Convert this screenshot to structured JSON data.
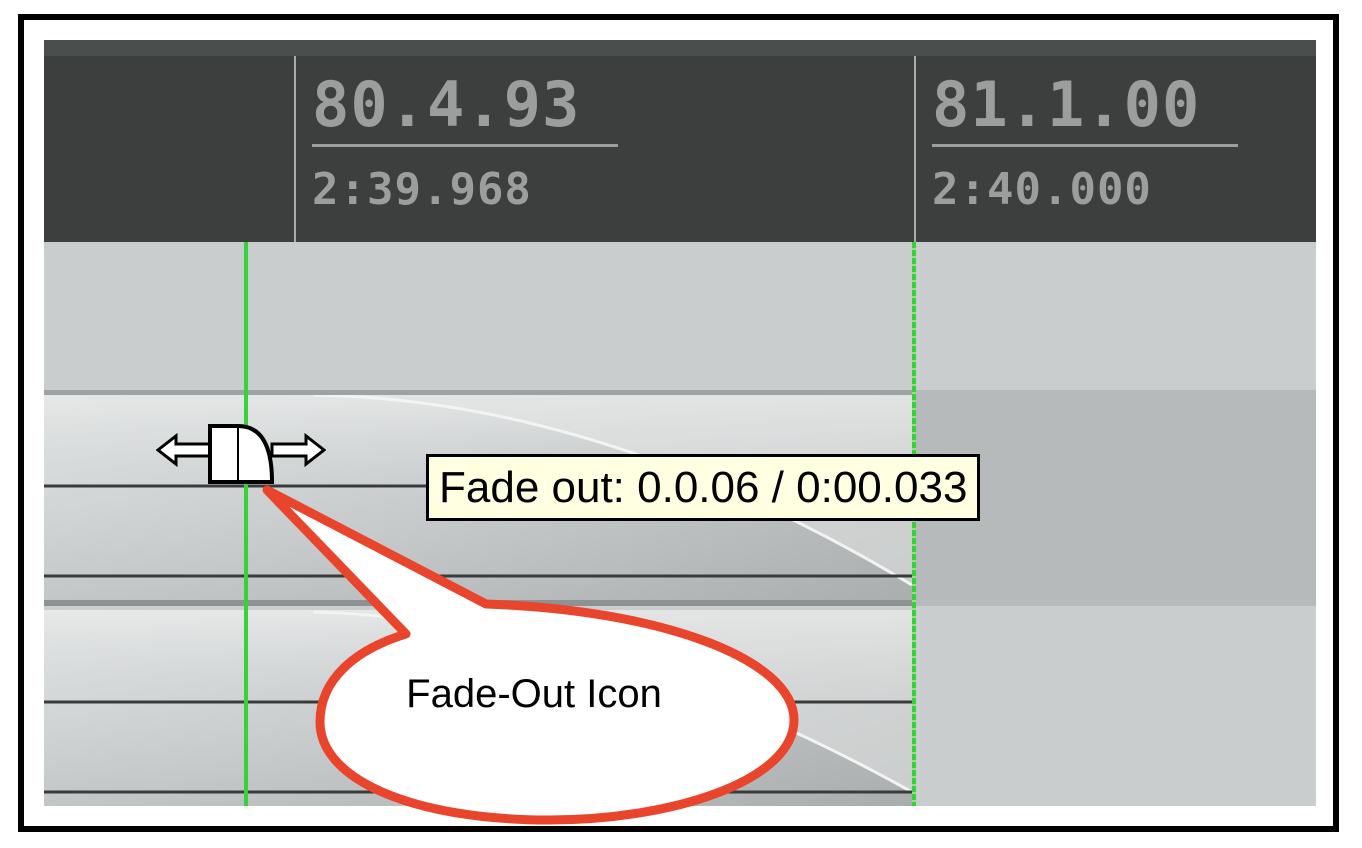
{
  "ruler": {
    "marker_1": {
      "beat": "80.4.93",
      "time": "2:39.968"
    },
    "marker_2": {
      "beat": "81.1.00",
      "time": "2:40.000"
    }
  },
  "tooltip": {
    "text": "Fade out: 0.0.06 / 0:00.033"
  },
  "callout": {
    "text": "Fade-Out Icon"
  },
  "icons": {
    "fade_handle": "fade-out-handle-icon"
  },
  "colors": {
    "ruler_bg": "#3c3f3e",
    "ruler_text": "#9c9e9d",
    "cursor_green": "#37d13a",
    "tooltip_bg": "#ffffe1",
    "callout_border": "#e8452c"
  }
}
